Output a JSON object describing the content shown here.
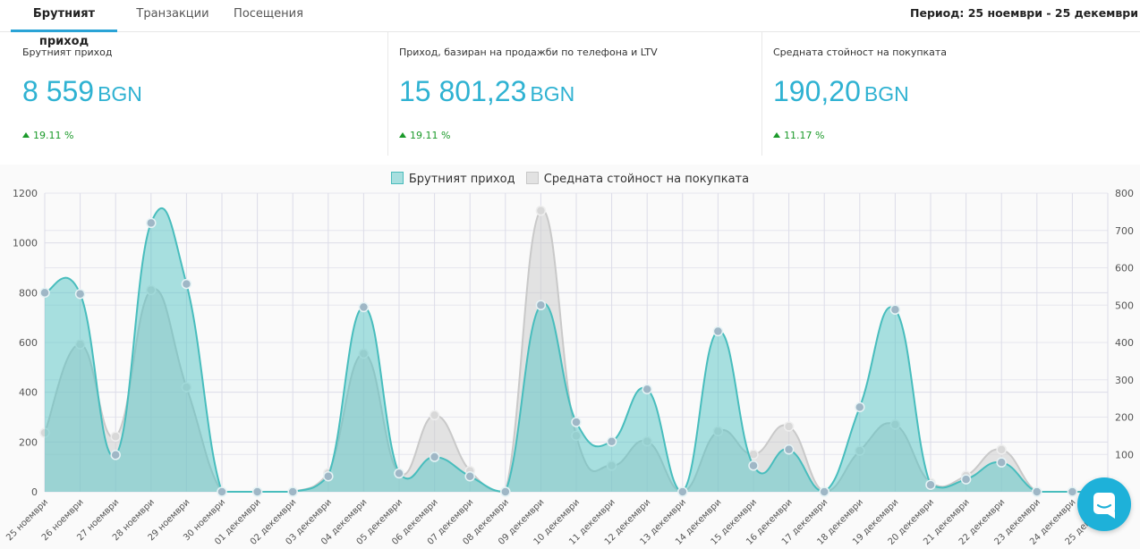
{
  "tabs": [
    {
      "label": "Брутният приход",
      "active": true
    },
    {
      "label": "Транзакции",
      "active": false
    },
    {
      "label": "Посещения",
      "active": false
    }
  ],
  "period": "Период: 25 ноември - 25 декември",
  "cards": [
    {
      "title": "Брутният приход",
      "value": "8 559",
      "unit": "BGN",
      "delta": "19.11 %"
    },
    {
      "title": "Приход, базиран на продажби по телефона и LTV",
      "value": "15 801,23",
      "unit": "BGN",
      "delta": "19.11 %"
    },
    {
      "title": "Средната стойност на покупката",
      "value": "190,20",
      "unit": "BGN",
      "delta": "11.17 %"
    }
  ],
  "legend": [
    {
      "label": "Брутният приход",
      "color": "#53c3c3"
    },
    {
      "label": "Средната стойност на покупката",
      "color": "#cccccc"
    }
  ],
  "chat_icon": "chat-bubble-icon",
  "chart_data": {
    "type": "area",
    "categories": [
      "25 ноември",
      "26 ноември",
      "27 ноември",
      "28 ноември",
      "29 ноември",
      "30 ноември",
      "01 декември",
      "02 декември",
      "03 декември",
      "04 декември",
      "05 декември",
      "06 декември",
      "07 декември",
      "08 декември",
      "09 декември",
      "10 декември",
      "11 декември",
      "12 декември",
      "13 декември",
      "14 декември",
      "15 декември",
      "16 декември",
      "17 декември",
      "18 декември",
      "19 декември",
      "20 декември",
      "21 декември",
      "22 декември",
      "23 декември",
      "24 декември",
      "25 декември"
    ],
    "series": [
      {
        "name": "Брутният приход",
        "axis": "left",
        "color": "#53c3c3",
        "values": [
          800,
          795,
          148,
          1080,
          835,
          0,
          0,
          0,
          62,
          742,
          74,
          140,
          62,
          0,
          750,
          280,
          202,
          412,
          0,
          645,
          105,
          170,
          0,
          340,
          732,
          28,
          50,
          118,
          0,
          0,
          0
        ]
      },
      {
        "name": "Средната стойность",
        "axis": "right",
        "color": "#cccccc",
        "values": [
          158,
          395,
          148,
          540,
          280,
          0,
          0,
          0,
          50,
          370,
          50,
          205,
          56,
          0,
          753,
          150,
          70,
          135,
          0,
          162,
          100,
          175,
          0,
          110,
          180,
          24,
          43,
          113,
          0,
          0,
          0
        ]
      }
    ],
    "yleft_ticks": [
      "0",
      "200",
      "400",
      "600",
      "800",
      "1000",
      "1200"
    ],
    "yright_ticks": [
      "0",
      "100",
      "200",
      "300",
      "400",
      "500",
      "600",
      "700",
      "800"
    ],
    "yleft_range": [
      0,
      1200
    ],
    "yright_range": [
      0,
      800
    ],
    "grid": true
  }
}
